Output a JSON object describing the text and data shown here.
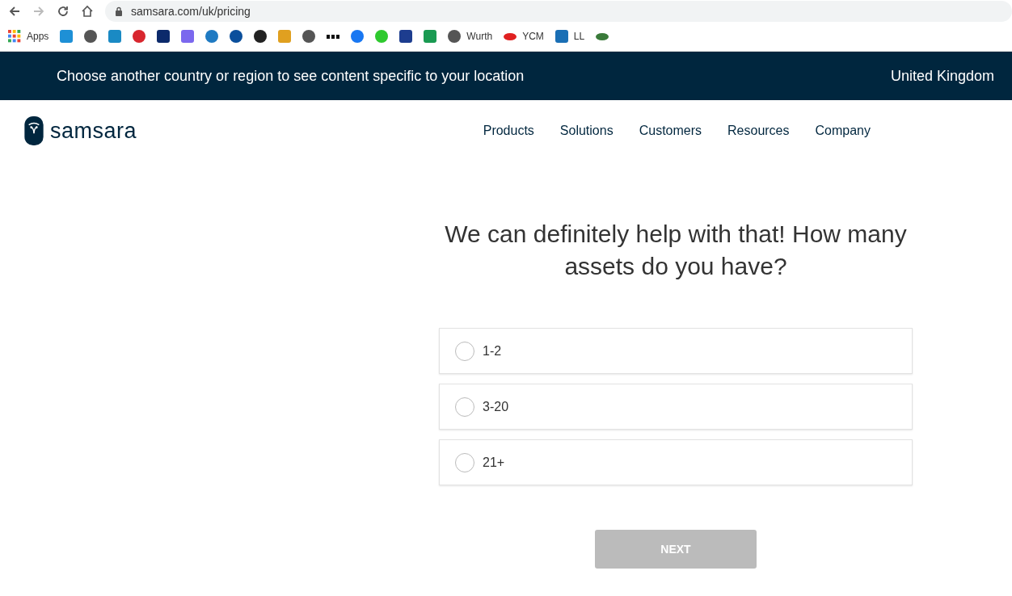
{
  "browser": {
    "url": "samsara.com/uk/pricing",
    "forward_disabled": true
  },
  "bookmarks": [
    {
      "kind": "apps",
      "label": "Apps"
    },
    {
      "kind": "tile",
      "color": "#1e90d6"
    },
    {
      "kind": "round",
      "color": "#555555"
    },
    {
      "kind": "tile",
      "color": "#1a8ac4"
    },
    {
      "kind": "round",
      "color": "#d8262e"
    },
    {
      "kind": "tile",
      "color": "#0c2a6b"
    },
    {
      "kind": "tile",
      "color": "#7b68ee"
    },
    {
      "kind": "round",
      "color": "#1f7ac2"
    },
    {
      "kind": "round",
      "color": "#0b4f9c"
    },
    {
      "kind": "round",
      "color": "#222222"
    },
    {
      "kind": "tile",
      "color": "#e0a020"
    },
    {
      "kind": "round",
      "color": "#555555"
    },
    {
      "kind": "dots",
      "color": "#111111"
    },
    {
      "kind": "round",
      "color": "#1877f2"
    },
    {
      "kind": "round",
      "color": "#2ec92e"
    },
    {
      "kind": "tile",
      "color": "#1d3d8f"
    },
    {
      "kind": "tile",
      "color": "#1a9a52"
    },
    {
      "kind": "round",
      "color": "#555555",
      "label": "Wurth"
    },
    {
      "kind": "oval",
      "color": "#e02020",
      "label": "YCM"
    },
    {
      "kind": "tile",
      "color": "#1a6fb5",
      "label": "LL"
    },
    {
      "kind": "oval",
      "color": "#3a7a3a"
    }
  ],
  "banner": {
    "text": "Choose another country or region to see content specific to your location",
    "country": "United Kingdom"
  },
  "header": {
    "logo": "samsara",
    "nav": [
      "Products",
      "Solutions",
      "Customers",
      "Resources",
      "Company"
    ]
  },
  "question": {
    "heading": "We can definitely help with that! How many assets do you have?",
    "options": [
      {
        "label": "1-2",
        "selected": false
      },
      {
        "label": "3-20",
        "selected": false
      },
      {
        "label": "21+",
        "selected": false
      }
    ]
  },
  "next_button": {
    "label": "NEXT",
    "disabled": true
  }
}
